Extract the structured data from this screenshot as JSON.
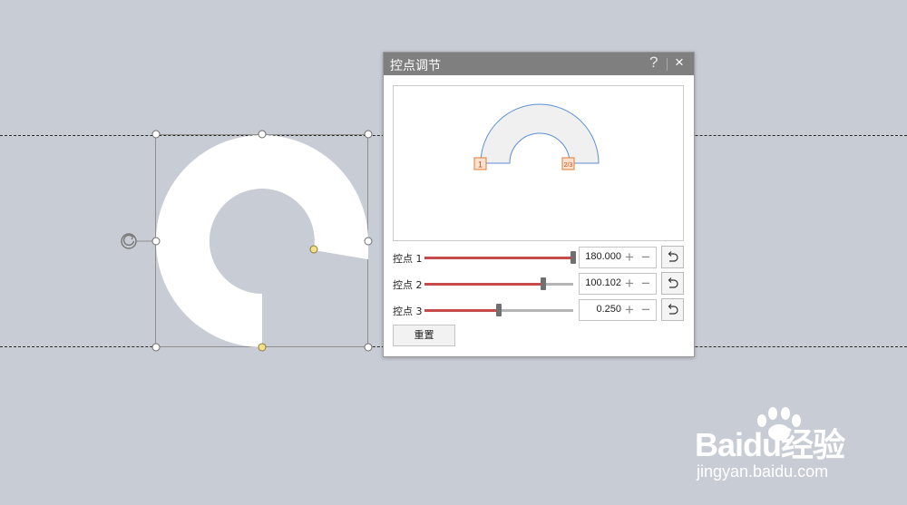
{
  "dialog": {
    "title": "控点调节",
    "help_label": "?",
    "close_label": "×",
    "reset_label": "重置"
  },
  "preview": {
    "handle1_label": "1",
    "handle23_label": "2/3"
  },
  "adjustments": [
    {
      "label": "控点 1",
      "value": "180.000",
      "level": 1.0
    },
    {
      "label": "控点 2",
      "value": "100.102",
      "level": 0.8
    },
    {
      "label": "控点 3",
      "value": "0.250",
      "level": 0.5
    }
  ],
  "watermark": {
    "brand": "Baidu经验",
    "url": "jingyan.baidu.com"
  },
  "colors": {
    "background": "#c8ccd5",
    "titlebar": "#7f7f7f",
    "slider_fill": "#c84b4b",
    "shape_fill": "#ffffff",
    "preview_outline": "#5b8fd8",
    "preview_fill": "#f0f0f0",
    "handle_yellow": "#f5e08a",
    "handle_marker": "#f0a060"
  },
  "icons": {
    "rotate": "rotate-handle-icon",
    "undo": "undo-icon",
    "close": "close-icon",
    "help": "help-icon"
  }
}
